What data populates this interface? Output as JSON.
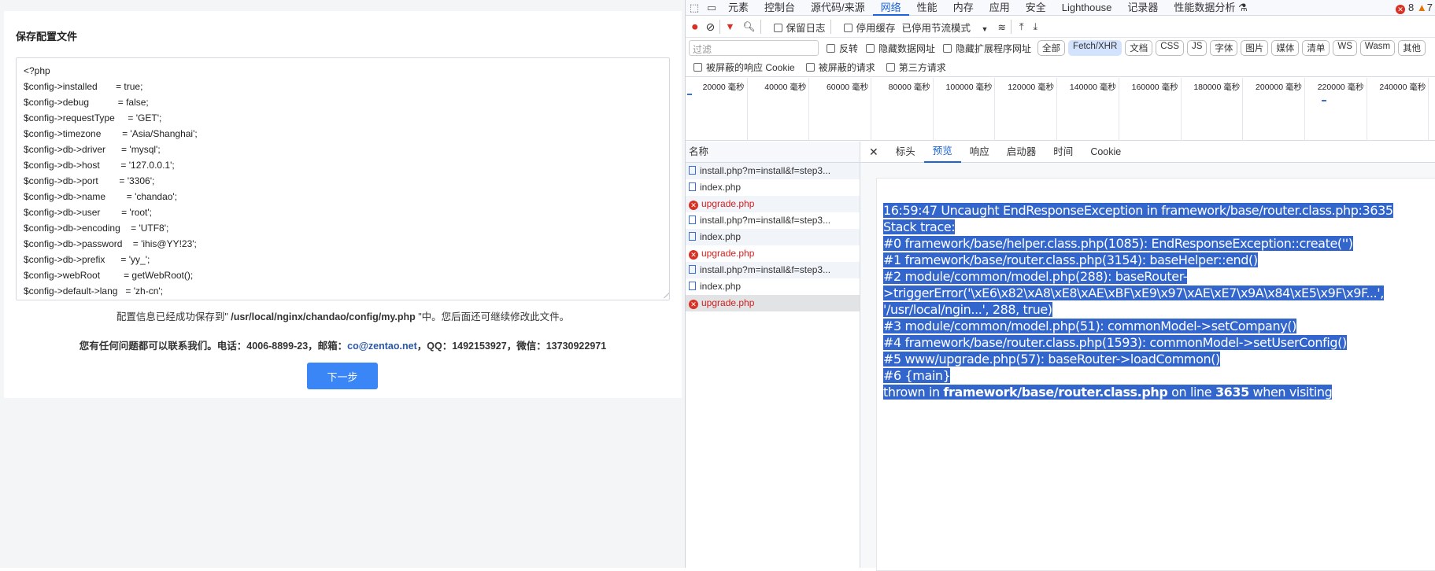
{
  "page": {
    "title": "保存配置文件",
    "config_lines": [
      "<?php",
      "$config->installed       = true;",
      "$config->debug           = false;",
      "$config->requestType     = 'GET';",
      "$config->timezone        = 'Asia/Shanghai';",
      "$config->db->driver      = 'mysql';",
      "$config->db->host        = '127.0.0.1';",
      "$config->db->port        = '3306';",
      "$config->db->name        = 'chandao';",
      "$config->db->user        = 'root';",
      "$config->db->encoding    = 'UTF8';",
      "$config->db->password    = 'ihis@YY!23';",
      "$config->db->prefix      = 'yy_';",
      "$config->webRoot         = getWebRoot();",
      "$config->default->lang   = 'zh-cn';"
    ],
    "saved_prefix": "配置信息已经成功保存到\" ",
    "saved_path": "/usr/local/nginx/chandao/config/my.php",
    "saved_suffix": " \"中。您后面还可继续修改此文件。",
    "contact_prefix": "您有任何问题都可以联系我们。电话：4006-8899-23，邮箱：",
    "contact_email": "co@zentao.net",
    "contact_suffix": "，QQ：1492153927，微信：13730922971",
    "next_button": "下一步"
  },
  "devtools": {
    "tabs": [
      "元素",
      "控制台",
      "源代码/来源",
      "网络",
      "性能",
      "内存",
      "应用",
      "安全",
      "Lighthouse",
      "记录器",
      "性能数据分析 ⚗"
    ],
    "active_tab": "网络",
    "errors": "8",
    "warnings": "7",
    "toolbar": {
      "preserve_log": "保留日志",
      "disable_cache": "停用缓存",
      "throttle": "已停用节流模式"
    },
    "filter_placeholder": "过滤",
    "filter_options": [
      "反转",
      "隐藏数据网址",
      "隐藏扩展程序网址"
    ],
    "type_chips": [
      "全部",
      "Fetch/XHR",
      "文档",
      "CSS",
      "JS",
      "字体",
      "图片",
      "媒体",
      "清单",
      "WS",
      "Wasm",
      "其他"
    ],
    "active_chip": "Fetch/XHR",
    "blocked_options": [
      "被屏蔽的响应 Cookie",
      "被屏蔽的请求",
      "第三方请求"
    ],
    "timeline_ticks": [
      "20000 毫秒",
      "40000 毫秒",
      "60000 毫秒",
      "80000 毫秒",
      "100000 毫秒",
      "120000 毫秒",
      "140000 毫秒",
      "160000 毫秒",
      "180000 毫秒",
      "200000 毫秒",
      "220000 毫秒",
      "240000 毫秒"
    ],
    "name_header": "名称",
    "requests": [
      {
        "name": "install.php?m=install&f=step3...",
        "error": false
      },
      {
        "name": "index.php",
        "error": false
      },
      {
        "name": "upgrade.php",
        "error": true
      },
      {
        "name": "install.php?m=install&f=step3...",
        "error": false
      },
      {
        "name": "index.php",
        "error": false
      },
      {
        "name": "upgrade.php",
        "error": true
      },
      {
        "name": "install.php?m=install&f=step3...",
        "error": false
      },
      {
        "name": "index.php",
        "error": false
      },
      {
        "name": "upgrade.php",
        "error": true
      }
    ],
    "detail_tabs": [
      "标头",
      "预览",
      "响应",
      "启动器",
      "时间",
      "Cookie"
    ],
    "active_detail_tab": "预览",
    "preview_lines": [
      "16:59:47 Uncaught EndResponseException in framework/base/router.class.php:3635",
      "Stack trace:",
      "#0 framework/base/helper.class.php(1085): EndResponseException::create('')",
      "#1 framework/base/router.class.php(3154): baseHelper::end()",
      "#2 module/common/model.php(288): baseRouter-",
      ">triggerError('\\xE6\\x82\\xA8\\xE8\\xAE\\xBF\\xE9\\x97\\xAE\\xE7\\x9A\\x84\\xE5\\x9F\\x9F...',",
      "'/usr/local/ngin...', 288, true)",
      "#3 module/common/model.php(51): commonModel->setCompany()",
      "#4 framework/base/router.class.php(1593): commonModel->setUserConfig()",
      "#5 www/upgrade.php(57): baseRouter->loadCommon()",
      "#6 {main}"
    ],
    "preview_last": [
      {
        "text": "thrown in ",
        "bold": false
      },
      {
        "text": "framework/base/router.class.php",
        "bold": true
      },
      {
        "text": " on line ",
        "bold": false
      },
      {
        "text": "3635",
        "bold": true
      },
      {
        "text": " when visiting",
        "bold": false
      }
    ],
    "colors": {
      "accent": "#1a64d6",
      "selection": "#3366cc",
      "button": "#3b86f7",
      "error": "#d93025"
    }
  }
}
